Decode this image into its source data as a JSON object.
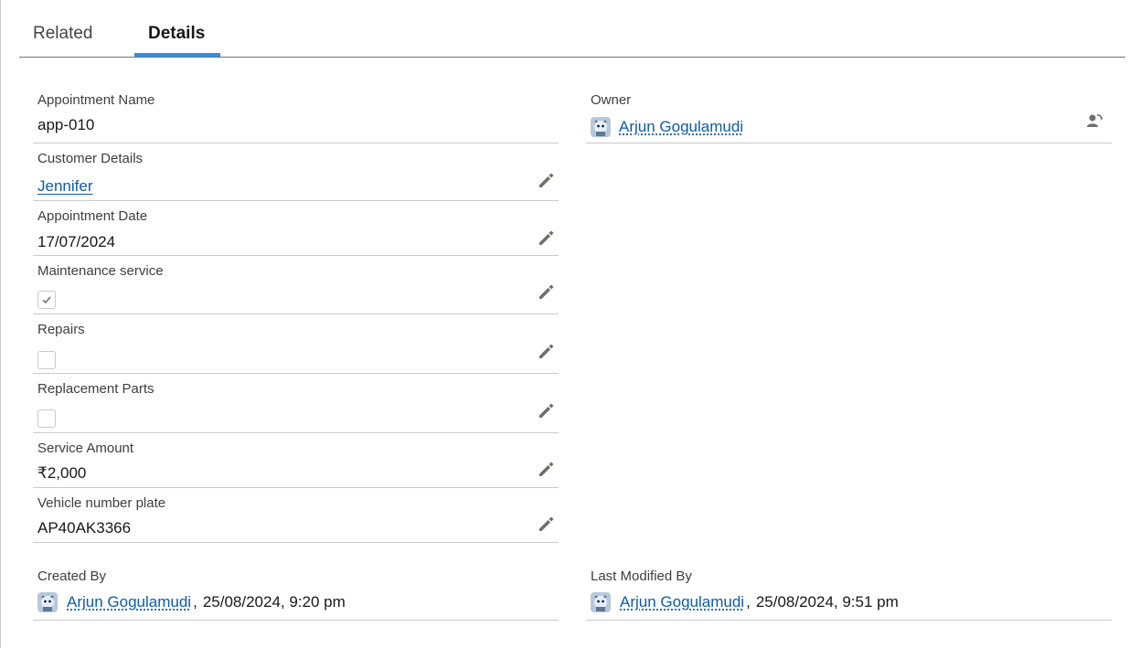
{
  "tabs": [
    {
      "label": "Related",
      "active": false
    },
    {
      "label": "Details",
      "active": true
    }
  ],
  "colors": {
    "accent": "#2e8ee8",
    "link": "#0b5cab",
    "border": "#c9c9c9"
  },
  "fields": {
    "appointment_name": {
      "label": "Appointment Name",
      "value": "app-010"
    },
    "customer_details": {
      "label": "Customer Details",
      "value": "Jennifer"
    },
    "appointment_date": {
      "label": "Appointment Date",
      "value": "17/07/2024"
    },
    "maintenance_service": {
      "label": "Maintenance service",
      "checked": true
    },
    "repairs": {
      "label": "Repairs",
      "checked": false
    },
    "replacement_parts": {
      "label": "Replacement Parts",
      "checked": false
    },
    "service_amount": {
      "label": "Service Amount",
      "value": "₹2,000"
    },
    "vehicle_number_plate": {
      "label": "Vehicle number plate",
      "value": "AP40AK3366"
    },
    "owner": {
      "label": "Owner",
      "name": "Arjun Gogulamudi",
      "icon": "change-owner-icon"
    },
    "created_by": {
      "label": "Created By",
      "name": "Arjun Gogulamudi",
      "separator": ",",
      "date": "25/08/2024, 9:20 pm"
    },
    "last_modified_by": {
      "label": "Last Modified By",
      "name": "Arjun Gogulamudi",
      "separator": ",",
      "date": "25/08/2024, 9:51 pm"
    }
  },
  "icons": {
    "edit": "pencil-icon",
    "avatar": "user-avatar-icon",
    "check": "checkmark-icon"
  }
}
